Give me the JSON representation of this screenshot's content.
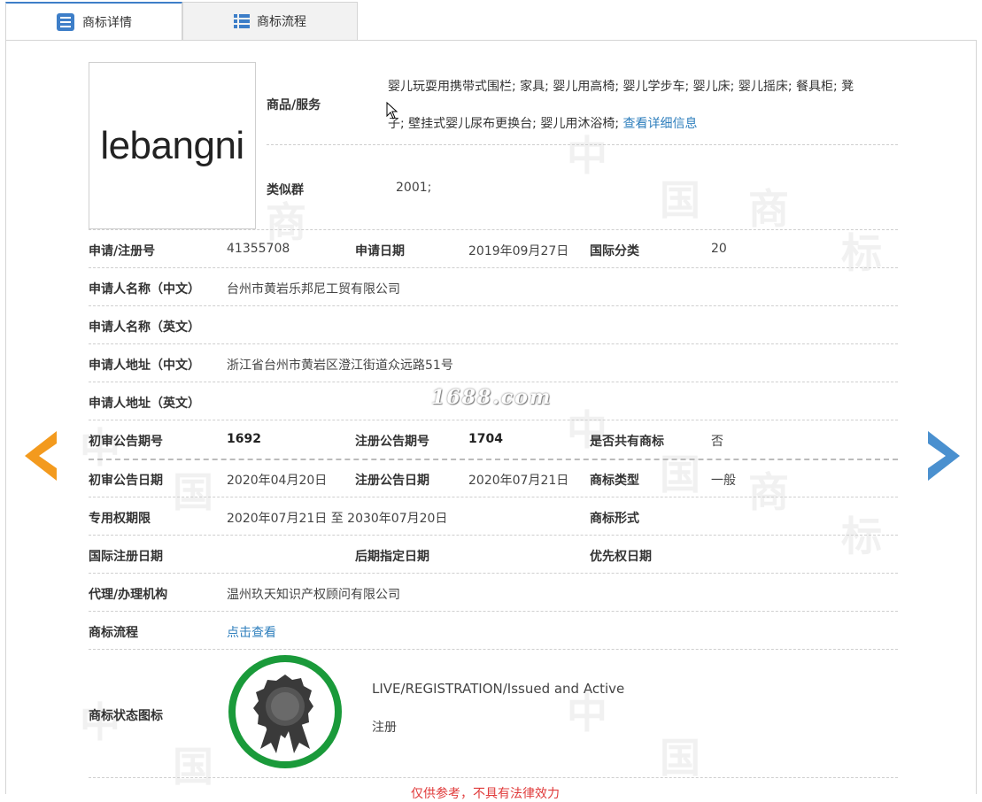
{
  "tabs": [
    {
      "label": "商标详情",
      "active": true,
      "icon": "list-doc-icon"
    },
    {
      "label": "商标流程",
      "active": false,
      "icon": "table-icon"
    }
  ],
  "logo": {
    "text": "lebangni"
  },
  "goods": {
    "label": "商品/服务",
    "line1": "婴儿玩耍用携带式围栏; 家具; 婴儿用高椅; 婴儿学步车; 婴儿床; 婴儿摇床; 餐具柜; 凳",
    "line2": "子; 壁挂式婴儿尿布更换台; 婴儿用沐浴椅;",
    "detail_link": "查看详细信息"
  },
  "similar_group": {
    "label": "类似群",
    "value": "2001;"
  },
  "rows": {
    "reg_no": {
      "label": "申请/注册号",
      "value": "41355708"
    },
    "apply_date": {
      "label": "申请日期",
      "value": "2019年09月27日"
    },
    "intl_class": {
      "label": "国际分类",
      "value": "20"
    },
    "applicant_cn": {
      "label": "申请人名称（中文）",
      "value": "台州市黄岩乐邦尼工贸有限公司"
    },
    "applicant_en": {
      "label": "申请人名称（英文）",
      "value": ""
    },
    "address_cn": {
      "label": "申请人地址（中文）",
      "value": "浙江省台州市黄岩区澄江街道众远路51号"
    },
    "address_en": {
      "label": "申请人地址（英文）",
      "value": ""
    },
    "prelim_issue": {
      "label": "初审公告期号",
      "value": "1692"
    },
    "reg_issue": {
      "label": "注册公告期号",
      "value": "1704"
    },
    "shared": {
      "label": "是否共有商标",
      "value": "否"
    },
    "prelim_date": {
      "label": "初审公告日期",
      "value": "2020年04月20日"
    },
    "reg_date": {
      "label": "注册公告日期",
      "value": "2020年07月21日"
    },
    "tm_type": {
      "label": "商标类型",
      "value": "一般"
    },
    "exclusive": {
      "label": "专用权期限",
      "value": "2020年07月21日 至 2030年07月20日"
    },
    "tm_form": {
      "label": "商标形式",
      "value": ""
    },
    "intl_reg_date": {
      "label": "国际注册日期",
      "value": ""
    },
    "later_date": {
      "label": "后期指定日期",
      "value": ""
    },
    "priority_date": {
      "label": "优先权日期",
      "value": ""
    },
    "agent": {
      "label": "代理/办理机构",
      "value": "温州玖天知识产权顾问有限公司"
    },
    "flow": {
      "label": "商标流程",
      "value": "点击查看"
    }
  },
  "status": {
    "label": "商标状态图标",
    "en": "LIVE/REGISTRATION/Issued and Active",
    "cn": "注册",
    "icon": "award-ribbon-icon",
    "ring_color": "#1a9a3a"
  },
  "site_watermark": "1688.com",
  "bg_watermark": [
    "中",
    "国",
    "商",
    "标"
  ],
  "footer_partial": "仅供参考，不具有法律效力",
  "colors": {
    "link": "#2f7fbd",
    "prev_arrow": "#f39a1e",
    "next_arrow": "#4a90cf",
    "tab_accent": "#3d7ec8"
  }
}
